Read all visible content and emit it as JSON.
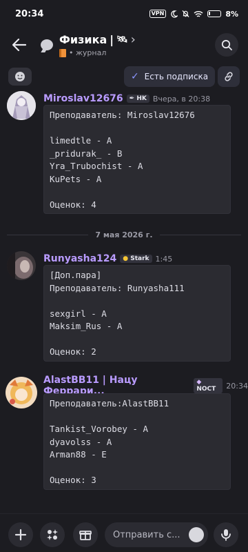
{
  "status_bar": {
    "time": "20:34",
    "vpn": "VPN",
    "battery": "8%"
  },
  "header": {
    "channel_name": "Физика",
    "channel_suffix": "|",
    "satellite_emoji": "🛰",
    "chevron": "›",
    "subtitle": "• журнал"
  },
  "actions": {
    "subscribe_label": "Есть подписка"
  },
  "messages": [
    {
      "username": "Miroslav12676",
      "tag": "HK",
      "time": "Вчера, в 20:38",
      "lines": [
        "Преподаватель: Miroslav12676",
        "",
        "limedtle - A",
        "_pridurak_ - B",
        "Yra_Trubochist - A",
        "KuPets - A",
        "",
        "Оценок: 4"
      ]
    },
    {
      "username": "Runyasha124",
      "tag": "Stark",
      "time": "1:45",
      "lines": [
        "[Доп.пара]",
        "Преподаватель: Runyasha111",
        "",
        "sexgirl - A",
        "Maksim_Rus - A",
        "",
        "Оценок: 2"
      ]
    },
    {
      "username": "AlastBB11 | Нацу Феррари...",
      "tag": "NOCT",
      "time": "20:34",
      "lines": [
        "Преподаватель:AlastBB11",
        "",
        "Tankist_Vorobey - A",
        "dyavolss - A",
        "Arman88 - E",
        "",
        "Оценок: 3"
      ]
    }
  ],
  "date_divider": "7 мая 2026 г.",
  "composer": {
    "placeholder": "Отправить с..."
  },
  "colors": {
    "background": "#1c1c21",
    "username": "#b99bff",
    "code_bg": "#2b2b31",
    "accent": "#8d97ff"
  }
}
